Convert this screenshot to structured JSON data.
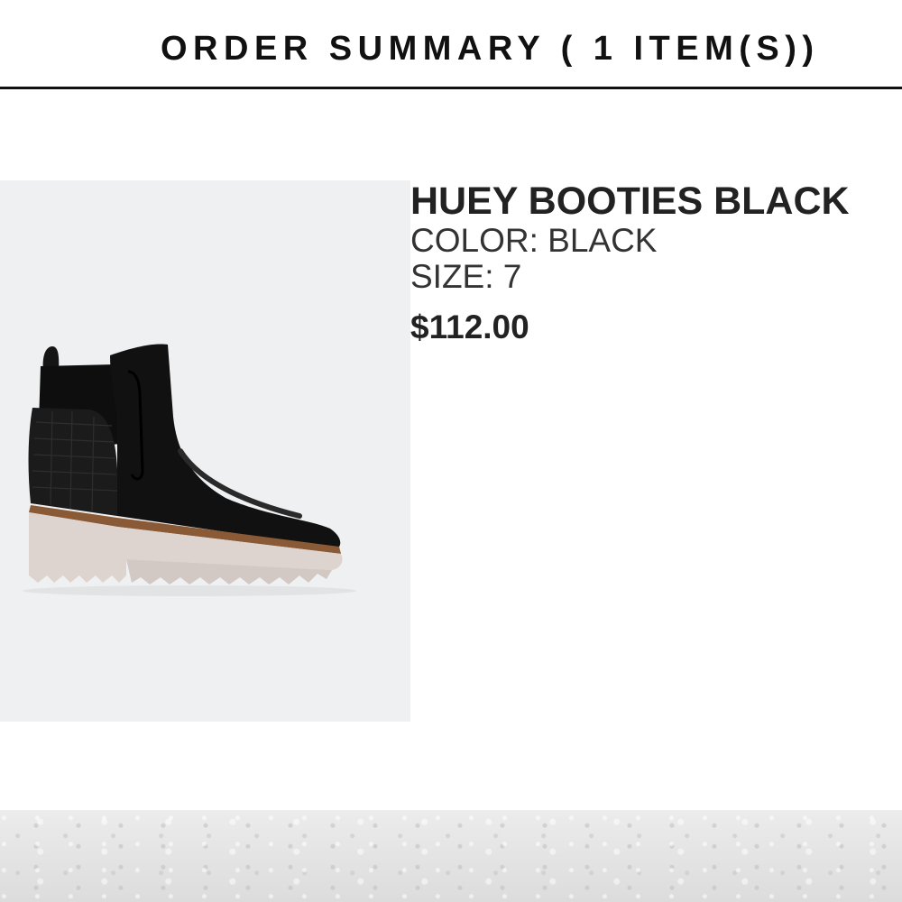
{
  "order_summary": {
    "title": "ORDER SUMMARY ( 1 ITEM(S))"
  },
  "item": {
    "name": "HUEY BOOTIES BLACK",
    "color_line": "COLOR: BLACK",
    "size_line": "SIZE: 7",
    "price": "$112.00",
    "image_icon": "black-ankle-boot-image"
  },
  "colors": {
    "text": "#222222",
    "image_background": "#eff0f1",
    "header_rule": "#111111"
  }
}
